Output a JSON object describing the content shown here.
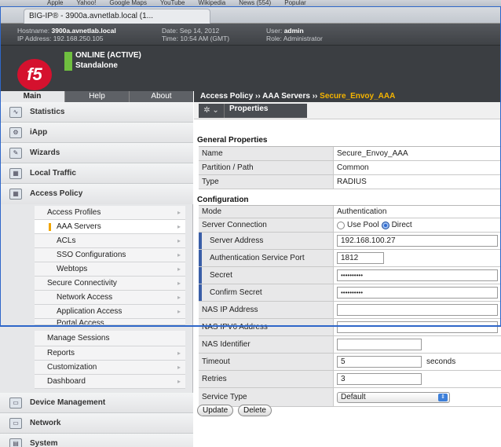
{
  "browser": {
    "bookmarks": [
      "Apple",
      "Yahoo!",
      "Google Maps",
      "YouTube",
      "Wikipedia",
      "News (554)",
      "Popular"
    ],
    "tab_title": "BIG-IP® - 3900a.avnetlab.local (1..."
  },
  "header": {
    "hostname_label": "Hostname:",
    "hostname": "3900a.avnetlab.local",
    "ip_label": "IP Address:",
    "ip": "192.168.250.105",
    "date_label": "Date:",
    "date": "Sep 14, 2012",
    "time_label": "Time:",
    "time": "10:54 AM (GMT)",
    "user_label": "User:",
    "user": "admin",
    "role_label": "Role:",
    "role": "Administrator",
    "status_line1": "ONLINE (ACTIVE)",
    "status_line2": "Standalone",
    "logo_text": "f5"
  },
  "sidebar": {
    "tabs": [
      "Main",
      "Help",
      "About"
    ],
    "sections": [
      "Statistics",
      "iApp",
      "Wizards",
      "Local Traffic",
      "Access Policy",
      "Device Management",
      "Network",
      "System"
    ],
    "access_policy_items": [
      "Access Profiles",
      "AAA Servers",
      "ACLs",
      "SSO Configurations",
      "Webtops",
      "Secure Connectivity",
      "Network Access",
      "Application Access",
      "Portal Access",
      "Manage Sessions",
      "Reports",
      "Customization",
      "Dashboard"
    ]
  },
  "main": {
    "breadcrumb_a": "Access Policy",
    "breadcrumb_b": "AAA Servers",
    "breadcrumb_c": "Secure_Envoy_AAA",
    "breadcrumb_sep": "››",
    "gear": "✲ ⌄",
    "properties_tab": "Properties",
    "general_title": "General Properties",
    "general": [
      {
        "k": "Name",
        "v": "Secure_Envoy_AAA"
      },
      {
        "k": "Partition / Path",
        "v": "Common"
      },
      {
        "k": "Type",
        "v": "RADIUS"
      }
    ],
    "config_title": "Configuration",
    "mode_label": "Mode",
    "mode_value": "Authentication",
    "server_conn_label": "Server Connection",
    "use_pool": "Use Pool",
    "direct": "Direct",
    "server_address_label": "Server Address",
    "server_address": "192.168.100.27",
    "auth_port_label": "Authentication Service Port",
    "auth_port": "1812",
    "secret_label": "Secret",
    "secret": "••••••••••",
    "confirm_label": "Confirm Secret",
    "confirm": "••••••••••",
    "nas_ip_label": "NAS IP Address",
    "nas_ipv6_label": "NAS IPV6 Address",
    "nas_id_label": "NAS Identifier",
    "timeout_label": "Timeout",
    "timeout": "5",
    "seconds": "seconds",
    "retries_label": "Retries",
    "retries": "3",
    "service_type_label": "Service Type",
    "service_type": "Default",
    "update": "Update",
    "delete": "Delete"
  }
}
